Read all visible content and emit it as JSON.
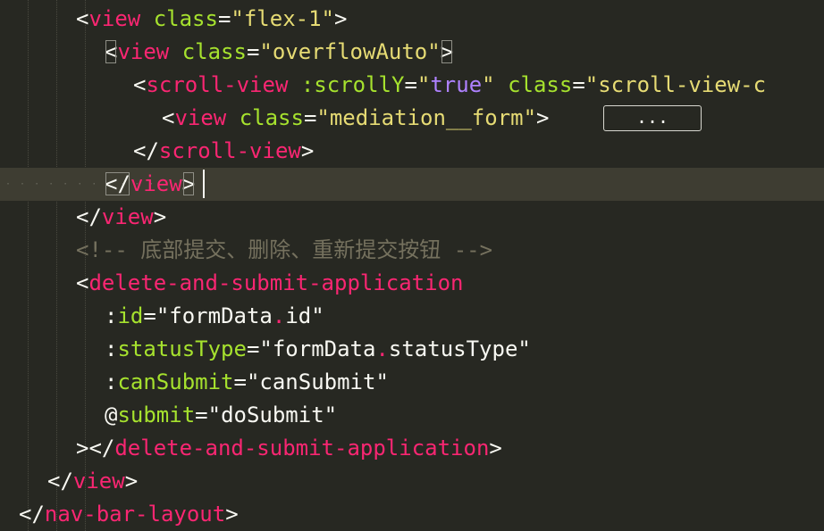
{
  "editor": {
    "colors": {
      "background": "#272822",
      "current_line": "#3e3d32",
      "tag": "#f92672",
      "attribute": "#a6e22e",
      "string": "#e6db74",
      "boolean": "#ae81ff",
      "comment": "#75715e",
      "punctuation": "#f8f8f2"
    },
    "lines": [
      {
        "open": "<",
        "tag": "view",
        "sp": " ",
        "attr": "class",
        "eq": "=",
        "val": "\"flex-1\"",
        "close": ">"
      },
      {
        "open": "<",
        "tag": "view",
        "sp": " ",
        "attr": "class",
        "eq": "=",
        "val": "\"overflowAuto\"",
        "close": ">"
      },
      {
        "open": "<",
        "tag": "scroll-view",
        "sp1": " ",
        "attr1": ":scrollY",
        "eq1": "=",
        "q1": "\"",
        "bool": "true",
        "q2": "\"",
        "sp2": " ",
        "attr2": "class",
        "eq2": "=",
        "val2": "\"scroll-view-c"
      },
      {
        "open": "<",
        "tag": "view",
        "sp": " ",
        "attr": "class",
        "eq": "=",
        "val": "\"mediation__form\"",
        "close": ">",
        "fold": "..."
      },
      {
        "open": "</",
        "tag": "scroll-view",
        "close": ">"
      },
      {
        "open": "</",
        "tag": "view",
        "close": ">",
        "indent_dots": "· · · · · · · · · · ·"
      },
      {
        "open": "</",
        "tag": "view",
        "close": ">"
      },
      {
        "comment": "<!-- ",
        "comment_text": "底部提交、删除、重新提交按钮",
        "comment_end": " -->"
      },
      {
        "open": "<",
        "tag": "delete-and-submit-application"
      },
      {
        "colon": ":",
        "attr": "id",
        "eq": "=",
        "q1": "\"",
        "obj": "formData",
        "dot": ".",
        "prop": "id",
        "q2": "\""
      },
      {
        "colon": ":",
        "attr": "statusType",
        "eq": "=",
        "q1": "\"",
        "obj": "formData",
        "dot": ".",
        "prop": "statusType",
        "q2": "\""
      },
      {
        "colon": ":",
        "attr": "canSubmit",
        "eq": "=",
        "q1": "\"",
        "obj": "canSubmit",
        "q2": "\""
      },
      {
        "colon": "@",
        "attr": "submit",
        "eq": "=",
        "q1": "\"",
        "obj": "doSubmit",
        "q2": "\""
      },
      {
        "open": "></",
        "tag": "delete-and-submit-application",
        "close": ">"
      },
      {
        "open": "</",
        "tag": "view",
        "close": ">"
      },
      {
        "open": "</",
        "tag": "nav-bar-layout",
        "close": ">"
      }
    ]
  }
}
